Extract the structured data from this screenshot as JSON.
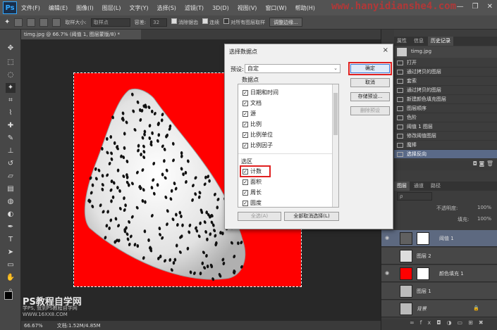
{
  "menubar": {
    "logo": "Ps",
    "items": [
      "文件(F)",
      "编辑(E)",
      "图像(I)",
      "图层(L)",
      "文字(Y)",
      "选择(S)",
      "滤镜(T)",
      "3D(D)",
      "视图(V)",
      "窗口(W)",
      "帮助(H)"
    ],
    "watermark": "www.hanyidianshe4.com"
  },
  "options": {
    "sample_size_label": "取样大小:",
    "sample_size_value": "取样点",
    "tolerance_label": "容差:",
    "tolerance_value": "32",
    "antialias": "消除锯齿",
    "contiguous": "连续",
    "all_layers": "对所有图层取样",
    "refine_edge": "调整边缘..."
  },
  "document": {
    "tab_title": "timg.jpg @ 66.7% (阈值 1, 图层蒙版/8) *",
    "zoom": "66.67%",
    "doc_info": "文档:1.52M/4.85M"
  },
  "brand": {
    "title": "PS教程自学网",
    "line1": "学PS, 就到PS教程自学网",
    "line2": "WWW.16XX8.COM"
  },
  "panels": {
    "top_tabs": [
      "属性",
      "信息",
      "历史记录"
    ],
    "history": {
      "snapshot": "timg.jpg",
      "items": [
        "打开",
        "通过拷贝的图层",
        "套索",
        "通过拷贝的图层",
        "新建颜色填充图层",
        "图层顺序",
        "色阶",
        "阈值 1 图层",
        "修改阈值图层",
        "魔棒",
        "选择反向"
      ]
    },
    "layer_tabs": [
      "图层",
      "通道",
      "路径"
    ],
    "opacity_label": "不透明度:",
    "opacity_value": "100%",
    "fill_label": "填充:",
    "fill_value": "100%",
    "layers": [
      {
        "name": "阈值 1"
      },
      {
        "name": "图层 2"
      },
      {
        "name": "颜色填充 1"
      },
      {
        "name": "图层 1"
      },
      {
        "name": "背景"
      }
    ]
  },
  "dialog": {
    "title": "选择数据点",
    "close": "×",
    "preset_label": "预设:",
    "preset_value": "自定",
    "datapoints_label": "数据点",
    "items_top": [
      "日期和时间",
      "文档",
      "源",
      "比例",
      "比例单位",
      "比例因子"
    ],
    "selection_header": "选区",
    "items_selection": [
      "计数",
      "面积",
      "周长",
      "圆度"
    ],
    "btn_ok": "确定",
    "btn_cancel": "取消",
    "btn_save": "存储预设...",
    "btn_delete": "删除预设",
    "btn_select_all": "全选(A)",
    "btn_deselect_all": "全部取消选择(L)"
  },
  "colors": {
    "canvas_bg": "#ff0000",
    "highlight": "#e02020",
    "selected_history": "#5a6a88"
  }
}
